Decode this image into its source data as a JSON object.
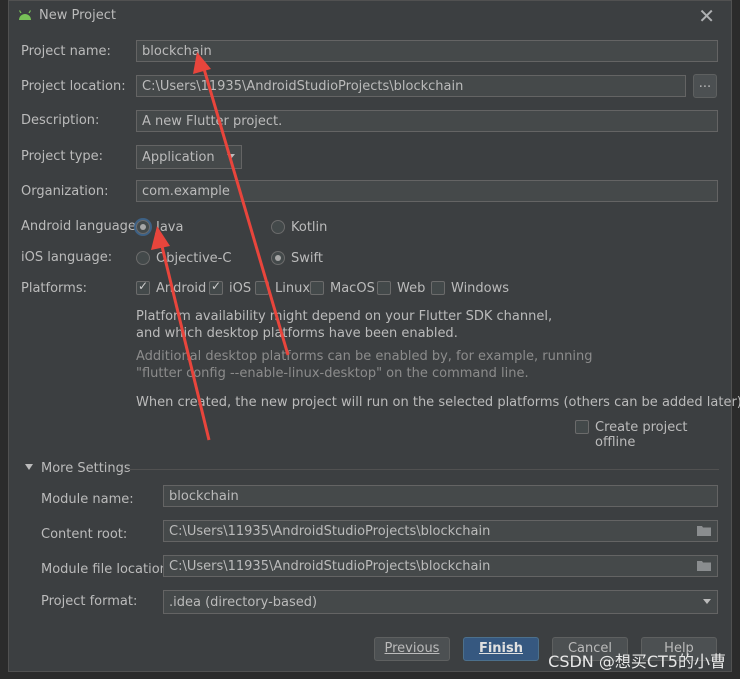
{
  "dialog": {
    "title": "New Project",
    "close_symbol": "✕"
  },
  "form": {
    "project_name": {
      "label": "Project name:",
      "value": "blockchain"
    },
    "project_location": {
      "label": "Project location:",
      "value": "C:\\Users\\11935\\AndroidStudioProjects\\blockchain",
      "browse": "..."
    },
    "description": {
      "label": "Description:",
      "value": "A new Flutter project."
    },
    "project_type": {
      "label": "Project type:",
      "value": "Application"
    },
    "organization": {
      "label": "Organization:",
      "value": "com.example"
    },
    "android_language": {
      "label": "Android language:",
      "options": [
        "Java",
        "Kotlin"
      ],
      "selected": "Java"
    },
    "ios_language": {
      "label": "iOS language:",
      "options": [
        "Objective-C",
        "Swift"
      ],
      "selected": "Swift"
    },
    "platforms": {
      "label": "Platforms:",
      "items": [
        {
          "name": "Android",
          "checked": true
        },
        {
          "name": "iOS",
          "checked": true
        },
        {
          "name": "Linux",
          "checked": false
        },
        {
          "name": "MacOS",
          "checked": false
        },
        {
          "name": "Web",
          "checked": false
        },
        {
          "name": "Windows",
          "checked": false
        }
      ]
    },
    "info1_line1": "Platform availability might depend on your Flutter SDK channel,",
    "info1_line2": "and which desktop platforms have been enabled.",
    "info2_line1": "Additional desktop platforms can be enabled by, for example, running",
    "info2_line2": "\"flutter config --enable-linux-desktop\" on the command line.",
    "info3": "When created, the new project will run on the selected platforms (others can be added later).",
    "create_offline": {
      "label": "Create project offline",
      "checked": false
    }
  },
  "more_settings": {
    "title": "More Settings",
    "module_name": {
      "label": "Module name:",
      "value": "blockchain"
    },
    "content_root": {
      "label": "Content root:",
      "value": "C:\\Users\\11935\\AndroidStudioProjects\\blockchain"
    },
    "module_file_location": {
      "label": "Module file location:",
      "value": "C:\\Users\\11935\\AndroidStudioProjects\\blockchain"
    },
    "project_format": {
      "label": "Project format:",
      "value": ".idea (directory-based)"
    }
  },
  "footer": {
    "previous": "Previous",
    "finish": "Finish",
    "cancel": "Cancel",
    "help": "Help"
  },
  "watermark": "CSDN @想买CT5的小曹",
  "colors": {
    "accent": "#365880",
    "arrow": "#e8453c",
    "background": "#3c3f41"
  }
}
